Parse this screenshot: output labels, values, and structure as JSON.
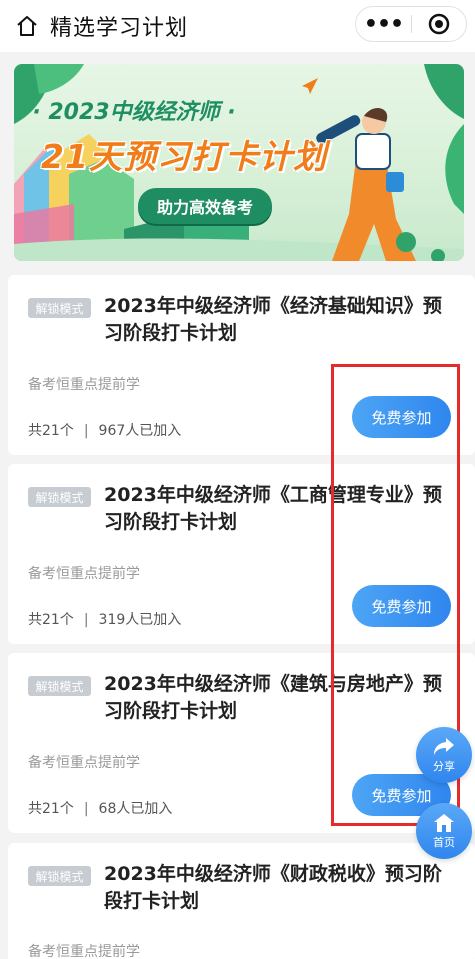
{
  "header": {
    "title": "精选学习计划",
    "more_label": "•••"
  },
  "banner": {
    "subtitle": "· 2023中级经济师 ·",
    "headline": "21天预习打卡计划",
    "pill": "助力高效备考"
  },
  "cards": [
    {
      "badge": "解锁模式",
      "title": "2023年中级经济师《经济基础知识》预习阶段打卡计划",
      "subtitle": "备考恒重点提前学",
      "count": "共21个",
      "joined": "967人已加入",
      "button": "免费参加"
    },
    {
      "badge": "解锁模式",
      "title": "2023年中级经济师《工商管理专业》预习阶段打卡计划",
      "subtitle": "备考恒重点提前学",
      "count": "共21个",
      "joined": "319人已加入",
      "button": "免费参加"
    },
    {
      "badge": "解锁模式",
      "title": "2023年中级经济师《建筑与房地产》预习阶段打卡计划",
      "subtitle": "备考恒重点提前学",
      "count": "共21个",
      "joined": "68人已加入",
      "button": "免费参加"
    },
    {
      "badge": "解锁模式",
      "title": "2023年中级经济师《财政税收》预习阶段打卡计划",
      "subtitle": "备考恒重点提前学"
    }
  ],
  "fab": {
    "share_label": "分享",
    "home_label": "首页"
  },
  "colors": {
    "accent_blue": "#2f86ee",
    "highlight_red": "#e52b2b",
    "banner_green": "#1f8d62",
    "banner_orange": "#f07d19"
  },
  "icons": [
    "home-outline-icon",
    "more-icon",
    "record-icon",
    "share-icon",
    "home-icon"
  ]
}
